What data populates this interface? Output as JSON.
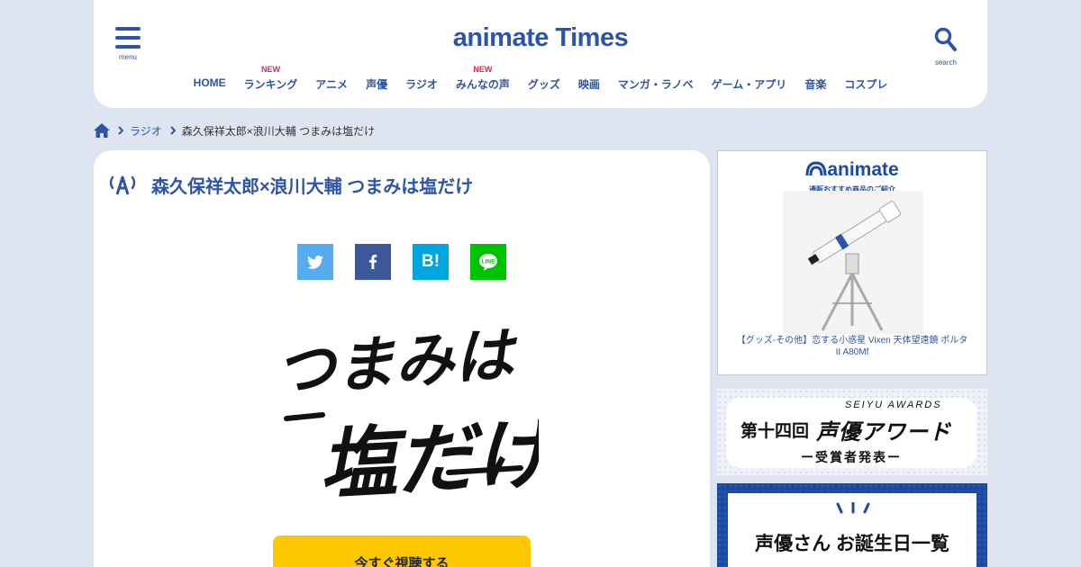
{
  "header": {
    "menu_label": "menu",
    "logo_prefix": "an",
    "logo_i": "i",
    "logo_rest": "mate Times",
    "search_label": "search",
    "nav": [
      {
        "label": "HOME",
        "badge": ""
      },
      {
        "label": "ランキング",
        "badge": "NEW"
      },
      {
        "label": "アニメ",
        "badge": ""
      },
      {
        "label": "声優",
        "badge": ""
      },
      {
        "label": "ラジオ",
        "badge": ""
      },
      {
        "label": "みんなの声",
        "badge": "NEW"
      },
      {
        "label": "グッズ",
        "badge": ""
      },
      {
        "label": "映画",
        "badge": ""
      },
      {
        "label": "マンガ・ラノベ",
        "badge": ""
      },
      {
        "label": "ゲーム・アプリ",
        "badge": ""
      },
      {
        "label": "音楽",
        "badge": ""
      },
      {
        "label": "コスプレ",
        "badge": ""
      }
    ]
  },
  "breadcrumb": {
    "category": "ラジオ",
    "current": "森久保祥太郎×浪川大輔 つまみは塩だけ"
  },
  "article": {
    "title": "森久保祥太郎×浪川大輔 つまみは塩だけ",
    "logo_line1": "つまみは",
    "logo_line2": "塩だけ",
    "share_hatena": "B!",
    "cta_label": "今すぐ視聴する"
  },
  "sidebar": {
    "ad": {
      "brand": "animate",
      "brand_sub": "通販おすすめ商品のご紹介",
      "caption": "【グッズ-その他】恋する小惑星 Vixen 天体望遠鏡 ポルタII A80Mf"
    },
    "award": {
      "number": "第十四回",
      "title": "声優アワード",
      "en": "SEIYU AWARDS",
      "sub": "ー受賞者発表ー"
    },
    "birthday": {
      "label": "声優さん お誕生日一覧"
    }
  },
  "colors": {
    "brand_blue": "#2e55a5",
    "new_badge": "#e0264d",
    "cta_yellow": "#fdc800",
    "page_bg": "#dfe4f1"
  }
}
